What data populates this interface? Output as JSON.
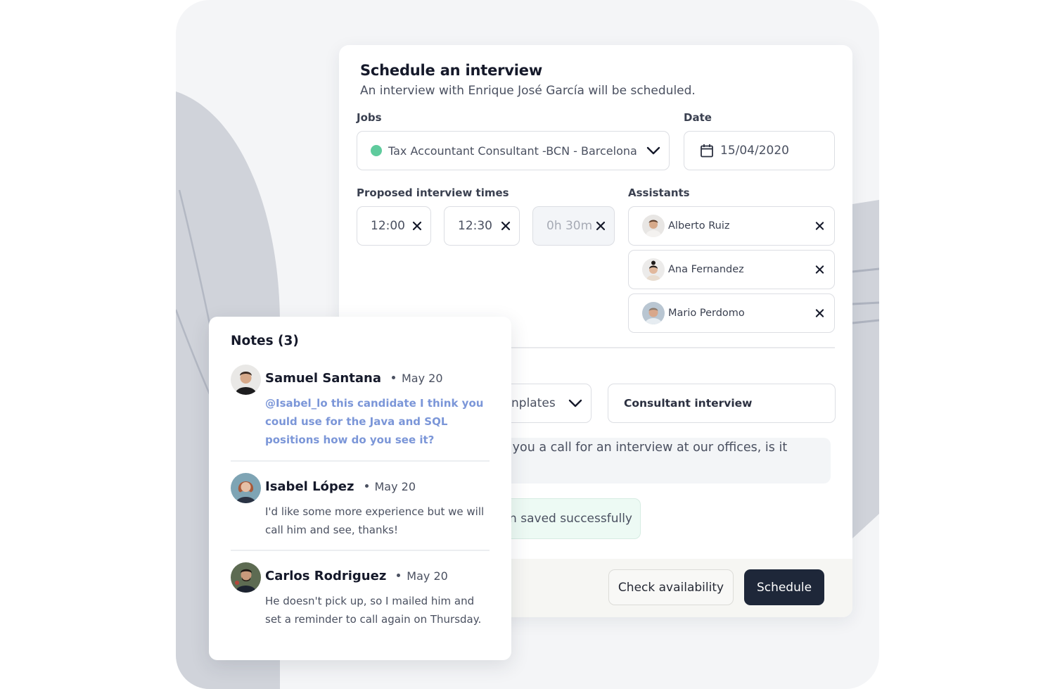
{
  "modal": {
    "title": "Schedule an interview",
    "subtitle": "An interview with Enrique José García will be scheduled.",
    "jobs": {
      "label": "Jobs",
      "value": "Tax Accountant Consultant -BCN - Barcelona",
      "status_color": "#5fcb9d",
      "icon": "chevron-down-icon"
    },
    "date": {
      "label": "Date",
      "value": "15/04/2020",
      "icon": "calendar-icon"
    },
    "times": {
      "label": "Proposed interview times",
      "start": "12:00",
      "end": "12:30",
      "duration": "0h 30m",
      "remove_icon": "close-icon"
    },
    "assistants": {
      "label": "Assistants",
      "items": [
        {
          "name": "Alberto Ruiz"
        },
        {
          "name": "Ana Fernandez"
        },
        {
          "name": "Mario Perdomo"
        }
      ],
      "remove_icon": "close-icon"
    },
    "templates": {
      "value": "nplates",
      "icon": "chevron-down-icon"
    },
    "subject": {
      "value": "Consultant interview"
    },
    "message": {
      "value": "g you a call for an interview at our offices, is it"
    },
    "toast": {
      "text": "een saved successfully"
    },
    "footer": {
      "check_label": "Check availability",
      "schedule_label": "Schedule"
    }
  },
  "notes": {
    "title": "Notes (3)",
    "items": [
      {
        "author": "Samuel Santana",
        "date": "May 20",
        "body": "@Isabel_lo this candidate I think you could use for the Java and SQL positions how do you see it?",
        "is_mention": true
      },
      {
        "author": "Isabel López",
        "date": "May 20",
        "body": "I'd like some more experience but we will call him and see, thanks!",
        "is_mention": false
      },
      {
        "author": "Carlos Rodriguez",
        "date": "May 20",
        "body": "He doesn't pick up, so I mailed him and set a reminder to call again on Thursday.",
        "is_mention": false
      }
    ]
  },
  "colors": {
    "primary_button": "#1e2739",
    "mention": "#7b96d8",
    "success_bg": "#edfaf4",
    "status_dot": "#5fcb9d"
  }
}
